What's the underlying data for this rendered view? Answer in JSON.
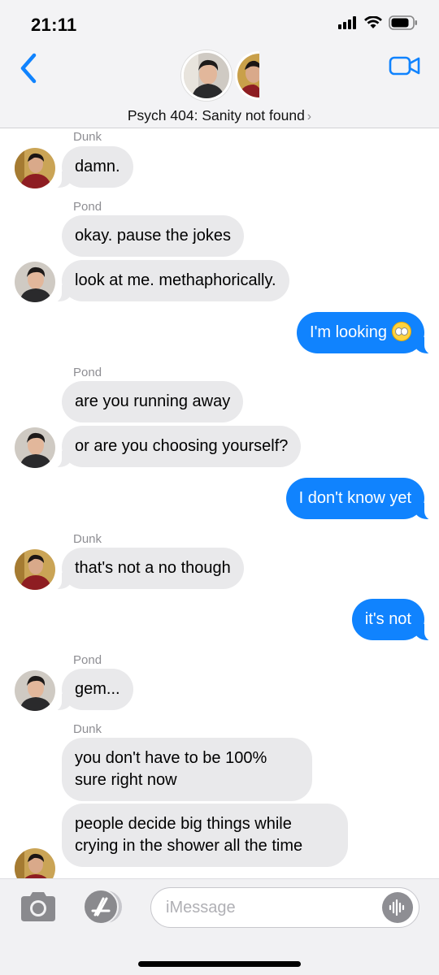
{
  "status": {
    "time": "21:11"
  },
  "header": {
    "title": "Psych 404: Sanity not found",
    "title_chevron": "›"
  },
  "messages": [
    {
      "type": "in",
      "sender": "Dunk",
      "text": "damn."
    },
    {
      "type": "in",
      "sender": "Pond",
      "text": "okay. pause the jokes"
    },
    {
      "type": "in",
      "text": "look at me. methaphorically."
    },
    {
      "type": "out",
      "text": "I'm looking",
      "emoji": "face-with-rolling-eyes"
    },
    {
      "type": "in",
      "sender": "Pond",
      "text": "are you running away"
    },
    {
      "type": "in",
      "text": "or are you choosing yourself?"
    },
    {
      "type": "out",
      "text": "I don't know yet"
    },
    {
      "type": "in",
      "sender": "Dunk",
      "text": "that's not a no though"
    },
    {
      "type": "out",
      "text": "it's not"
    },
    {
      "type": "in",
      "sender": "Pond",
      "text": "gem..."
    },
    {
      "type": "in",
      "sender": "Dunk",
      "text": "you don't have to be 100% sure right now"
    },
    {
      "type": "in",
      "text": "people decide big things while crying in the shower all the time"
    }
  ],
  "input": {
    "placeholder": "iMessage"
  },
  "colors": {
    "outgoing": "#1083fe",
    "incoming": "#e9e9eb",
    "accent": "#1083fe"
  }
}
